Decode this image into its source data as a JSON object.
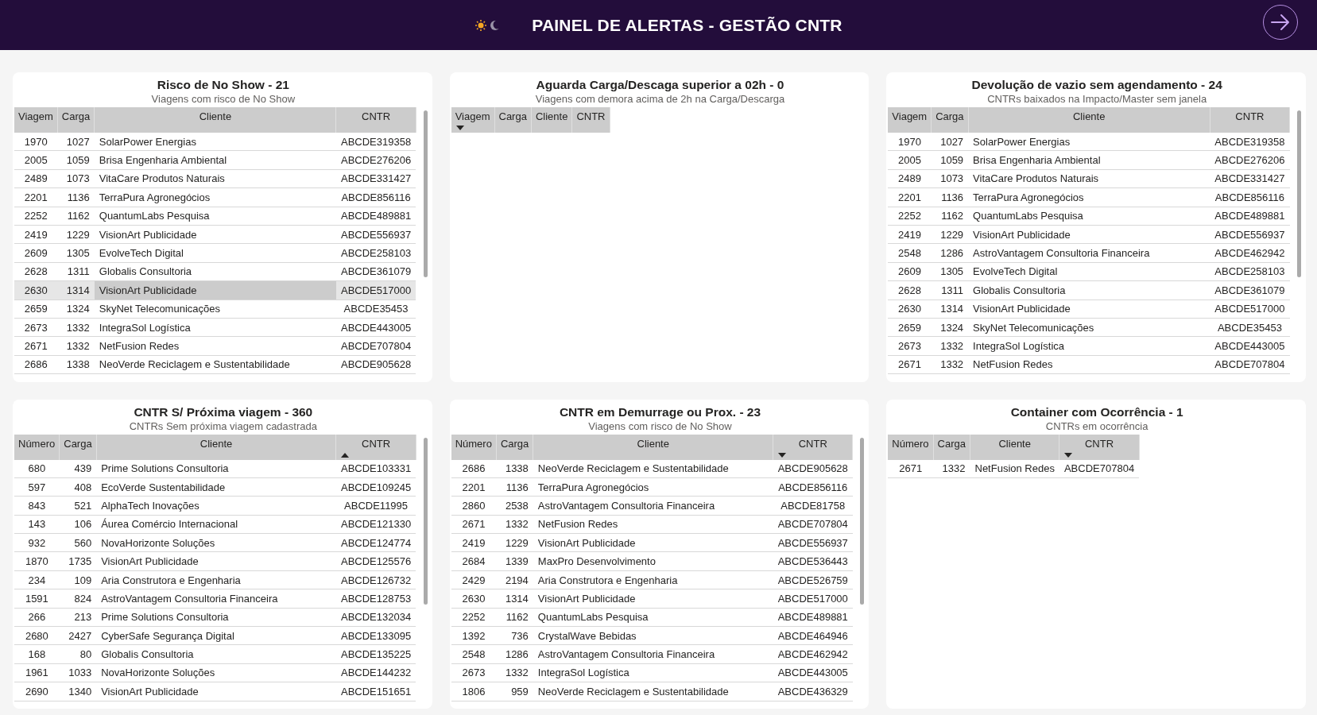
{
  "header": {
    "title": "PAINEL DE ALERTAS - GESTÃO CNTR"
  },
  "panels": [
    {
      "title": "Risco de No Show - 21",
      "subtitle": "Viagens com risco de No Show",
      "columns": [
        {
          "label": "Viagem",
          "sorted": false
        },
        {
          "label": "Carga",
          "sorted": false
        },
        {
          "label": "Cliente",
          "sorted": false
        },
        {
          "label": "CNTR",
          "sorted": false
        }
      ],
      "rows": [
        {
          "cells": [
            "1970",
            "1027",
            "SolarPower Energias",
            "ABCDE319358"
          ],
          "selected": false
        },
        {
          "cells": [
            "2005",
            "1059",
            "Brisa Engenharia Ambiental",
            "ABCDE276206"
          ],
          "selected": false
        },
        {
          "cells": [
            "2489",
            "1073",
            "VitaCare Produtos Naturais",
            "ABCDE331427"
          ],
          "selected": false
        },
        {
          "cells": [
            "2201",
            "1136",
            "TerraPura Agronegócios",
            "ABCDE856116"
          ],
          "selected": false
        },
        {
          "cells": [
            "2252",
            "1162",
            "QuantumLabs Pesquisa",
            "ABCDE489881"
          ],
          "selected": false
        },
        {
          "cells": [
            "2419",
            "1229",
            "VisionArt Publicidade",
            "ABCDE556937"
          ],
          "selected": false
        },
        {
          "cells": [
            "2609",
            "1305",
            "EvolveTech Digital",
            "ABCDE258103"
          ],
          "selected": false
        },
        {
          "cells": [
            "2628",
            "1311",
            "Globalis Consultoria",
            "ABCDE361079"
          ],
          "selected": false
        },
        {
          "cells": [
            "2630",
            "1314",
            "VisionArt Publicidade",
            "ABCDE517000"
          ],
          "selected": true
        },
        {
          "cells": [
            "2659",
            "1324",
            "SkyNet Telecomunicações",
            "ABCDE35453"
          ],
          "selected": false
        },
        {
          "cells": [
            "2673",
            "1332",
            "IntegraSol Logística",
            "ABCDE443005"
          ],
          "selected": false
        },
        {
          "cells": [
            "2671",
            "1332",
            "NetFusion Redes",
            "ABCDE707804"
          ],
          "selected": false
        },
        {
          "cells": [
            "2686",
            "1338",
            "NeoVerde Reciclagem e Sustentabilidade",
            "ABCDE905628"
          ],
          "selected": false
        }
      ]
    },
    {
      "title": "Aguarda Carga/Descaga superior a 02h - 0",
      "subtitle": "Viagens com demora acima de 2h na Carga/Descarga",
      "columns": [
        {
          "label": "Viagem",
          "sorted": true,
          "ascending": false
        },
        {
          "label": "Carga",
          "sorted": false
        },
        {
          "label": "Cliente",
          "sorted": false
        },
        {
          "label": "CNTR",
          "sorted": false
        }
      ]
    },
    {
      "title": "Devolução de vazio sem agendamento - 24",
      "subtitle": "CNTRs baixados na Impacto/Master sem janela",
      "columns": [
        {
          "label": "Viagem",
          "sorted": false
        },
        {
          "label": "Carga",
          "sorted": false
        },
        {
          "label": "Cliente",
          "sorted": false
        },
        {
          "label": "CNTR",
          "sorted": false
        }
      ],
      "rows": [
        {
          "cells": [
            "1970",
            "1027",
            "SolarPower Energias",
            "ABCDE319358"
          ],
          "selected": false
        },
        {
          "cells": [
            "2005",
            "1059",
            "Brisa Engenharia Ambiental",
            "ABCDE276206"
          ],
          "selected": false
        },
        {
          "cells": [
            "2489",
            "1073",
            "VitaCare Produtos Naturais",
            "ABCDE331427"
          ],
          "selected": false
        },
        {
          "cells": [
            "2201",
            "1136",
            "TerraPura Agronegócios",
            "ABCDE856116"
          ],
          "selected": false
        },
        {
          "cells": [
            "2252",
            "1162",
            "QuantumLabs Pesquisa",
            "ABCDE489881"
          ],
          "selected": false
        },
        {
          "cells": [
            "2419",
            "1229",
            "VisionArt Publicidade",
            "ABCDE556937"
          ],
          "selected": false
        },
        {
          "cells": [
            "2548",
            "1286",
            "AstroVantagem Consultoria Financeira",
            "ABCDE462942"
          ],
          "selected": false
        },
        {
          "cells": [
            "2609",
            "1305",
            "EvolveTech Digital",
            "ABCDE258103"
          ],
          "selected": false
        },
        {
          "cells": [
            "2628",
            "1311",
            "Globalis Consultoria",
            "ABCDE361079"
          ],
          "selected": false
        },
        {
          "cells": [
            "2630",
            "1314",
            "VisionArt Publicidade",
            "ABCDE517000"
          ],
          "selected": false
        },
        {
          "cells": [
            "2659",
            "1324",
            "SkyNet Telecomunicações",
            "ABCDE35453"
          ],
          "selected": false
        },
        {
          "cells": [
            "2673",
            "1332",
            "IntegraSol Logística",
            "ABCDE443005"
          ],
          "selected": false
        },
        {
          "cells": [
            "2671",
            "1332",
            "NetFusion Redes",
            "ABCDE707804"
          ],
          "selected": false
        }
      ]
    },
    {
      "title": "CNTR S/ Próxima viagem - 360",
      "subtitle": "CNTRs Sem próxima viagem cadastrada",
      "columns": [
        {
          "label": "Número",
          "sorted": false
        },
        {
          "label": "Carga",
          "sorted": false
        },
        {
          "label": "Cliente",
          "sorted": false
        },
        {
          "label": "CNTR",
          "sorted": true,
          "ascending": true
        }
      ],
      "rows": [
        {
          "cells": [
            "680",
            "439",
            "Prime Solutions Consultoria",
            "ABCDE103331"
          ],
          "selected": false
        },
        {
          "cells": [
            "597",
            "408",
            "EcoVerde Sustentabilidade",
            "ABCDE109245"
          ],
          "selected": false
        },
        {
          "cells": [
            "843",
            "521",
            "AlphaTech Inovações",
            "ABCDE11995"
          ],
          "selected": false
        },
        {
          "cells": [
            "143",
            "106",
            "Áurea Comércio Internacional",
            "ABCDE121330"
          ],
          "selected": false
        },
        {
          "cells": [
            "932",
            "560",
            "NovaHorizonte Soluções",
            "ABCDE124774"
          ],
          "selected": false
        },
        {
          "cells": [
            "1870",
            "1735",
            "VisionArt Publicidade",
            "ABCDE125576"
          ],
          "selected": false
        },
        {
          "cells": [
            "234",
            "109",
            "Aria Construtora e Engenharia",
            "ABCDE126732"
          ],
          "selected": false
        },
        {
          "cells": [
            "1591",
            "824",
            "AstroVantagem Consultoria Financeira",
            "ABCDE128753"
          ],
          "selected": false
        },
        {
          "cells": [
            "266",
            "213",
            "Prime Solutions Consultoria",
            "ABCDE132034"
          ],
          "selected": false
        },
        {
          "cells": [
            "2680",
            "2427",
            "CyberSafe Segurança Digital",
            "ABCDE133095"
          ],
          "selected": false
        },
        {
          "cells": [
            "168",
            "80",
            "Globalis Consultoria",
            "ABCDE135225"
          ],
          "selected": false
        },
        {
          "cells": [
            "1961",
            "1033",
            "NovaHorizonte Soluções",
            "ABCDE144232"
          ],
          "selected": false
        },
        {
          "cells": [
            "2690",
            "1340",
            "VisionArt Publicidade",
            "ABCDE151651"
          ],
          "selected": false
        }
      ]
    },
    {
      "title": "CNTR em Demurrage ou Prox. - 23",
      "subtitle": "Viagens com risco de No Show",
      "columns": [
        {
          "label": "Número",
          "sorted": false
        },
        {
          "label": "Carga",
          "sorted": false
        },
        {
          "label": "Cliente",
          "sorted": false
        },
        {
          "label": "CNTR",
          "sorted": true,
          "ascending": false
        }
      ],
      "rows": [
        {
          "cells": [
            "2686",
            "1338",
            "NeoVerde Reciclagem e Sustentabilidade",
            "ABCDE905628"
          ],
          "selected": false
        },
        {
          "cells": [
            "2201",
            "1136",
            "TerraPura Agronegócios",
            "ABCDE856116"
          ],
          "selected": false
        },
        {
          "cells": [
            "2860",
            "2538",
            "AstroVantagem Consultoria Financeira",
            "ABCDE81758"
          ],
          "selected": false
        },
        {
          "cells": [
            "2671",
            "1332",
            "NetFusion Redes",
            "ABCDE707804"
          ],
          "selected": false
        },
        {
          "cells": [
            "2419",
            "1229",
            "VisionArt Publicidade",
            "ABCDE556937"
          ],
          "selected": false
        },
        {
          "cells": [
            "2684",
            "1339",
            "MaxPro Desenvolvimento",
            "ABCDE536443"
          ],
          "selected": false
        },
        {
          "cells": [
            "2429",
            "2194",
            "Aria Construtora e Engenharia",
            "ABCDE526759"
          ],
          "selected": false
        },
        {
          "cells": [
            "2630",
            "1314",
            "VisionArt Publicidade",
            "ABCDE517000"
          ],
          "selected": false
        },
        {
          "cells": [
            "2252",
            "1162",
            "QuantumLabs Pesquisa",
            "ABCDE489881"
          ],
          "selected": false
        },
        {
          "cells": [
            "1392",
            "736",
            "CrystalWave Bebidas",
            "ABCDE464946"
          ],
          "selected": false
        },
        {
          "cells": [
            "2548",
            "1286",
            "AstroVantagem Consultoria Financeira",
            "ABCDE462942"
          ],
          "selected": false
        },
        {
          "cells": [
            "2673",
            "1332",
            "IntegraSol Logística",
            "ABCDE443005"
          ],
          "selected": false
        },
        {
          "cells": [
            "1806",
            "959",
            "NeoVerde Reciclagem e Sustentabilidade",
            "ABCDE436329"
          ],
          "selected": false
        }
      ]
    },
    {
      "title": "Container com Ocorrência - 1",
      "subtitle": "CNTRs em ocorrência",
      "columns": [
        {
          "label": "Número",
          "sorted": false
        },
        {
          "label": "Carga",
          "sorted": false
        },
        {
          "label": "Cliente",
          "sorted": false
        },
        {
          "label": "CNTR",
          "sorted": true,
          "ascending": false
        }
      ],
      "rows": [
        {
          "cells": [
            "2671",
            "1332",
            "NetFusion Redes",
            "ABCDE707804"
          ],
          "selected": false
        }
      ]
    }
  ]
}
